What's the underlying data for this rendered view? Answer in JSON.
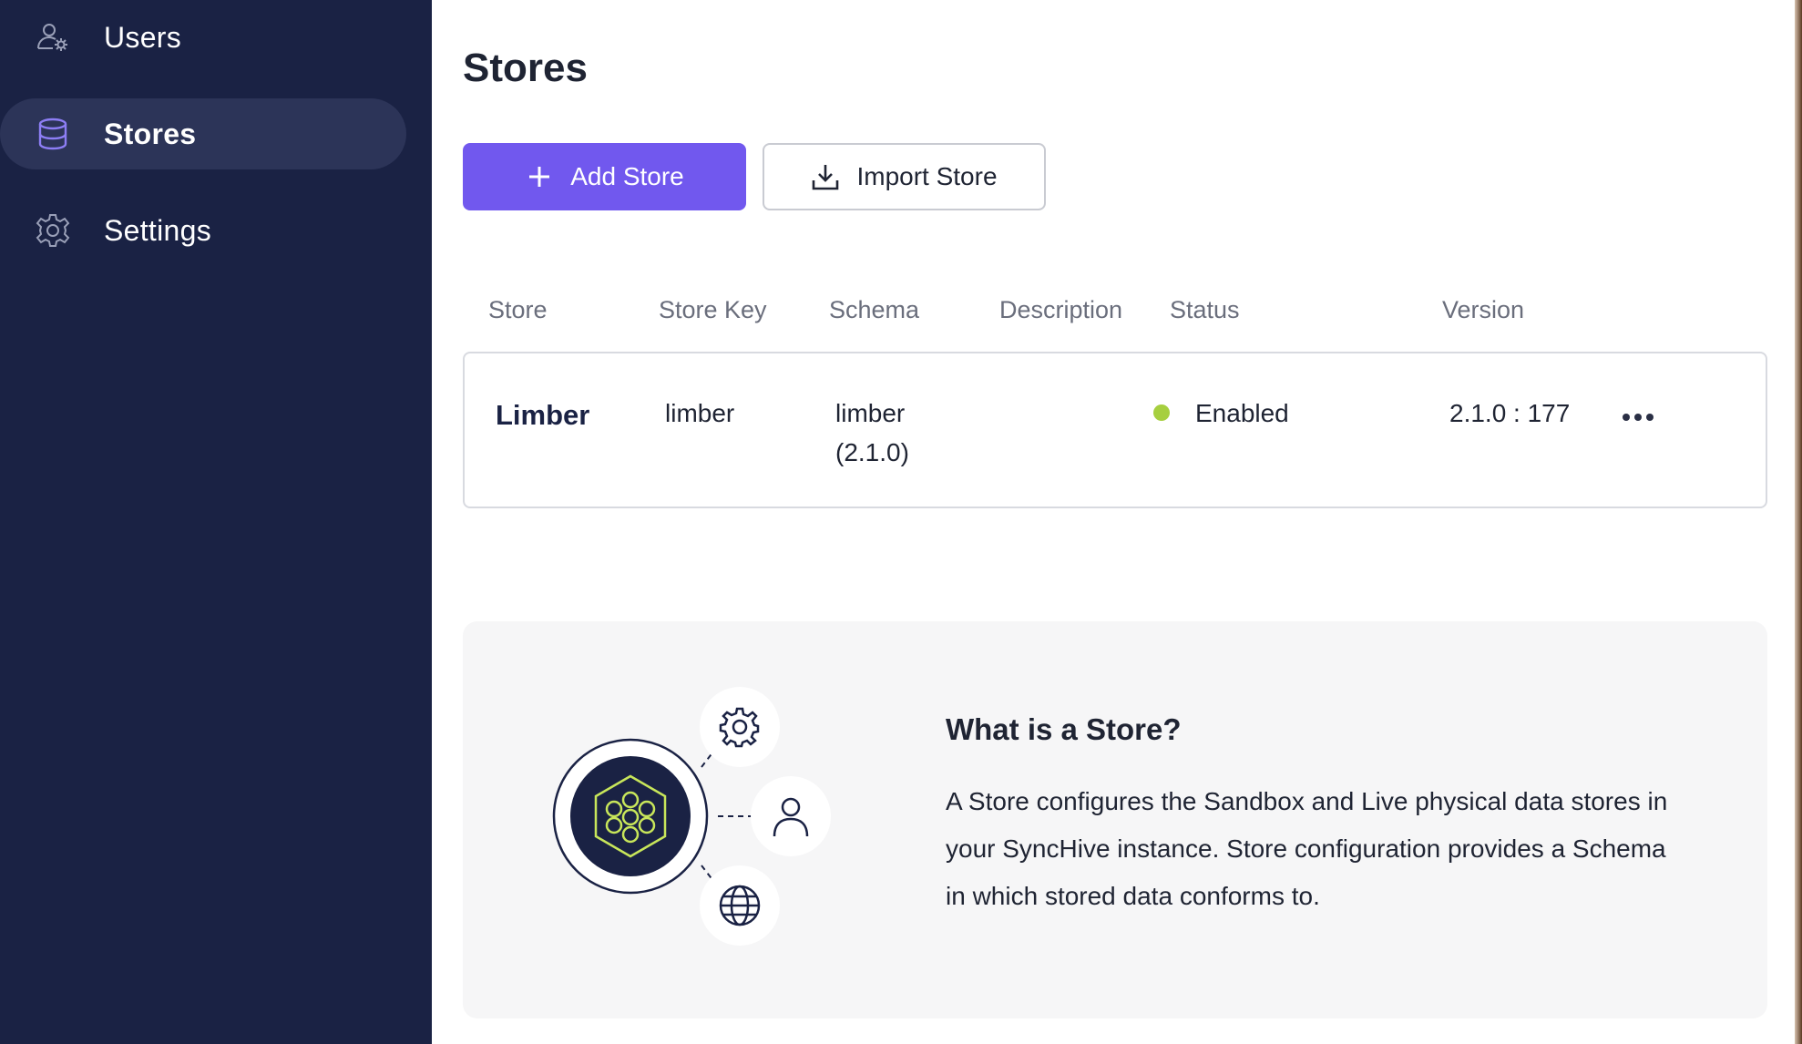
{
  "sidebar": {
    "items": [
      {
        "label": "Users",
        "icon": "user-cog-icon",
        "active": false
      },
      {
        "label": "Stores",
        "icon": "database-icon",
        "active": true
      },
      {
        "label": "Settings",
        "icon": "gear-icon",
        "active": false
      }
    ]
  },
  "main": {
    "title": "Stores",
    "add_button": {
      "label": "Add Store",
      "icon": "plus-icon"
    },
    "import_button": {
      "label": "Import Store",
      "icon": "download-icon"
    },
    "table": {
      "columns": [
        "Store",
        "Store Key",
        "Schema",
        "Description",
        "Status",
        "Version"
      ],
      "rows": [
        {
          "store": "Limber",
          "store_key": "limber",
          "schema_line1": "limber",
          "schema_line2": "(2.1.0)",
          "description": "",
          "status": "Enabled",
          "status_color": "#a6cf3f",
          "version": "2.1.0 : 177"
        }
      ]
    },
    "info": {
      "title": "What is a Store?",
      "body": "A Store configures the Sandbox and Live physical data stores in your SyncHive instance. Store configuration provides a Schema in which stored data conforms to."
    }
  },
  "colors": {
    "sidebar_bg": "#1a2244",
    "sidebar_active": "#2c3458",
    "primary": "#7158ee",
    "status_enabled": "#a6cf3f",
    "illustration_accent": "#c8e65a"
  }
}
